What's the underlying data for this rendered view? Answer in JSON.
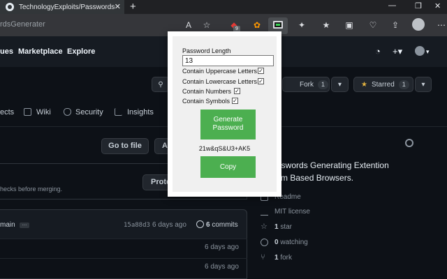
{
  "browser": {
    "tab_title": "TechnologyExploits/PasswordsGe",
    "tab_close": "✕",
    "new_tab": "+",
    "url_text": "rdsGenerater",
    "win_controls": [
      "—",
      "❐",
      "✕"
    ],
    "ext_badge_count": "9"
  },
  "github": {
    "nav": [
      "ues",
      "Marketplace",
      "Explore"
    ],
    "header_right": {
      "bell": "🔔",
      "plus": "+▾",
      "avatar_caret": "▾"
    },
    "repo_buttons": {
      "fork_label": "Fork",
      "fork_count": "1",
      "starred_label": "Starred",
      "star_count": "1"
    },
    "tabs": [
      "ects",
      "Wiki",
      "Security",
      "Insights"
    ],
    "go_to_file": "Go to file",
    "add_file": "Add file",
    "checks_text": "hecks before merging.",
    "protect_button": "Protect",
    "commit": {
      "branch": "main",
      "sha": "15a88d3",
      "ago": "6 days ago",
      "commit_count": "6",
      "commits_label": "commits"
    },
    "file_rows": [
      {
        "time": "6 days ago"
      },
      {
        "time": "6 days ago"
      }
    ],
    "about": {
      "desc_line1": "n Passwords Generating Extention",
      "desc_line2": "romium Based Browsers.",
      "readme": "Readme",
      "license": "MIT license",
      "stars_count": "1",
      "stars_label": "star",
      "watching_count": "0",
      "watching_label": "watching",
      "fork_count": "1",
      "fork_label": "fork"
    }
  },
  "popup": {
    "length_label": "Password Length",
    "length_value": "13",
    "options": [
      {
        "label": "Contain Uppercase Letters",
        "checked": true
      },
      {
        "label": "Contain Lowercase Letters",
        "checked": true
      },
      {
        "label": "Contain Numbers",
        "checked": true
      },
      {
        "label": "Contain Symbols",
        "checked": true
      }
    ],
    "generate_label_1": "Generate",
    "generate_label_2": "Password",
    "generated_password": "21w&qS&U3+AK5",
    "copy_label": "Copy",
    "check_glyph": "✓"
  },
  "colors": {
    "popup_button": "#4caf50",
    "github_bg": "#0d1117",
    "header_bg": "#161b22"
  }
}
